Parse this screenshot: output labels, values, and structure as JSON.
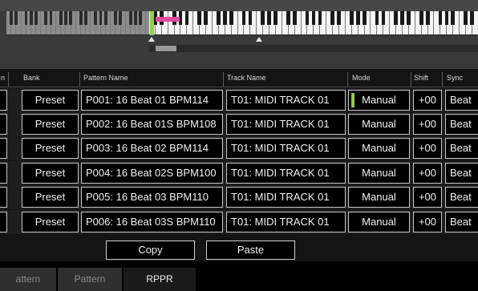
{
  "keyboard": {
    "colors": {
      "highlight_keys": "#e24b9b",
      "range_marker": "#8fd14a"
    }
  },
  "table": {
    "headers": {
      "left_partial": "n",
      "bank": "Bank",
      "pattern_name": "Pattern Name",
      "track_name": "Track Name",
      "mode": "Mode",
      "shift": "Shift",
      "sync": "Sync"
    },
    "rows": [
      {
        "bank": "Preset",
        "pattern": "P001: 16 Beat 01 BPM114",
        "track": "T01: MIDI TRACK 01",
        "mode": "Manual",
        "shift": "+00",
        "sync": "Beat",
        "mode_active": true
      },
      {
        "bank": "Preset",
        "pattern": "P002: 16 Beat 01S BPM108",
        "track": "T01: MIDI TRACK 01",
        "mode": "Manual",
        "shift": "+00",
        "sync": "Beat",
        "mode_active": false
      },
      {
        "bank": "Preset",
        "pattern": "P003: 16 Beat 02 BPM114",
        "track": "T01: MIDI TRACK 01",
        "mode": "Manual",
        "shift": "+00",
        "sync": "Beat",
        "mode_active": false
      },
      {
        "bank": "Preset",
        "pattern": "P004: 16 Beat 02S BPM100",
        "track": "T01: MIDI TRACK 01",
        "mode": "Manual",
        "shift": "+00",
        "sync": "Beat",
        "mode_active": false
      },
      {
        "bank": "Preset",
        "pattern": "P005: 16 Beat 03 BPM110",
        "track": "T01: MIDI TRACK 01",
        "mode": "Manual",
        "shift": "+00",
        "sync": "Beat",
        "mode_active": false
      },
      {
        "bank": "Preset",
        "pattern": "P006: 16 Beat 03S BPM110",
        "track": "T01: MIDI TRACK 01",
        "mode": "Manual",
        "shift": "+00",
        "sync": "Beat",
        "mode_active": false
      }
    ]
  },
  "buttons": {
    "copy": "Copy",
    "paste": "Paste"
  },
  "tabs": [
    {
      "label": "attern",
      "active": false
    },
    {
      "label": "Pattern",
      "active": false
    },
    {
      "label": "RPPR",
      "active": true
    }
  ]
}
